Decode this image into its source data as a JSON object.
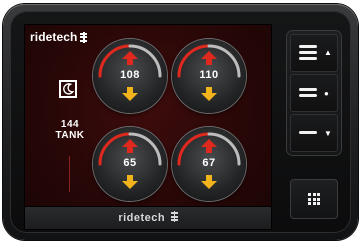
{
  "brand": {
    "name": "ridetech",
    "footer_name": "ridetech"
  },
  "status": {
    "mode_icon": "moon-icon",
    "tank_value": "144",
    "tank_label": "TANK"
  },
  "gauges": [
    {
      "value": "108",
      "up_icon": "arrow-up-icon",
      "down_icon": "arrow-down-icon"
    },
    {
      "value": "110",
      "up_icon": "arrow-up-icon",
      "down_icon": "arrow-down-icon"
    },
    {
      "value": "65",
      "up_icon": "arrow-up-icon",
      "down_icon": "arrow-down-icon"
    },
    {
      "value": "67",
      "up_icon": "arrow-up-icon",
      "down_icon": "arrow-down-icon"
    }
  ],
  "hardware_buttons": [
    {
      "name": "preset-high-button",
      "indicator": "▲"
    },
    {
      "name": "preset-ride-button",
      "indicator": "●"
    },
    {
      "name": "preset-low-button",
      "indicator": "▼"
    }
  ],
  "menu_button": {
    "icon": "grid-icon"
  },
  "colors": {
    "screen_bg": "#2a0707",
    "arrow_up": "#e0291e",
    "arrow_down": "#f2b41c",
    "arc_red": "#e0291e",
    "arc_grey": "#bdbdbd"
  }
}
